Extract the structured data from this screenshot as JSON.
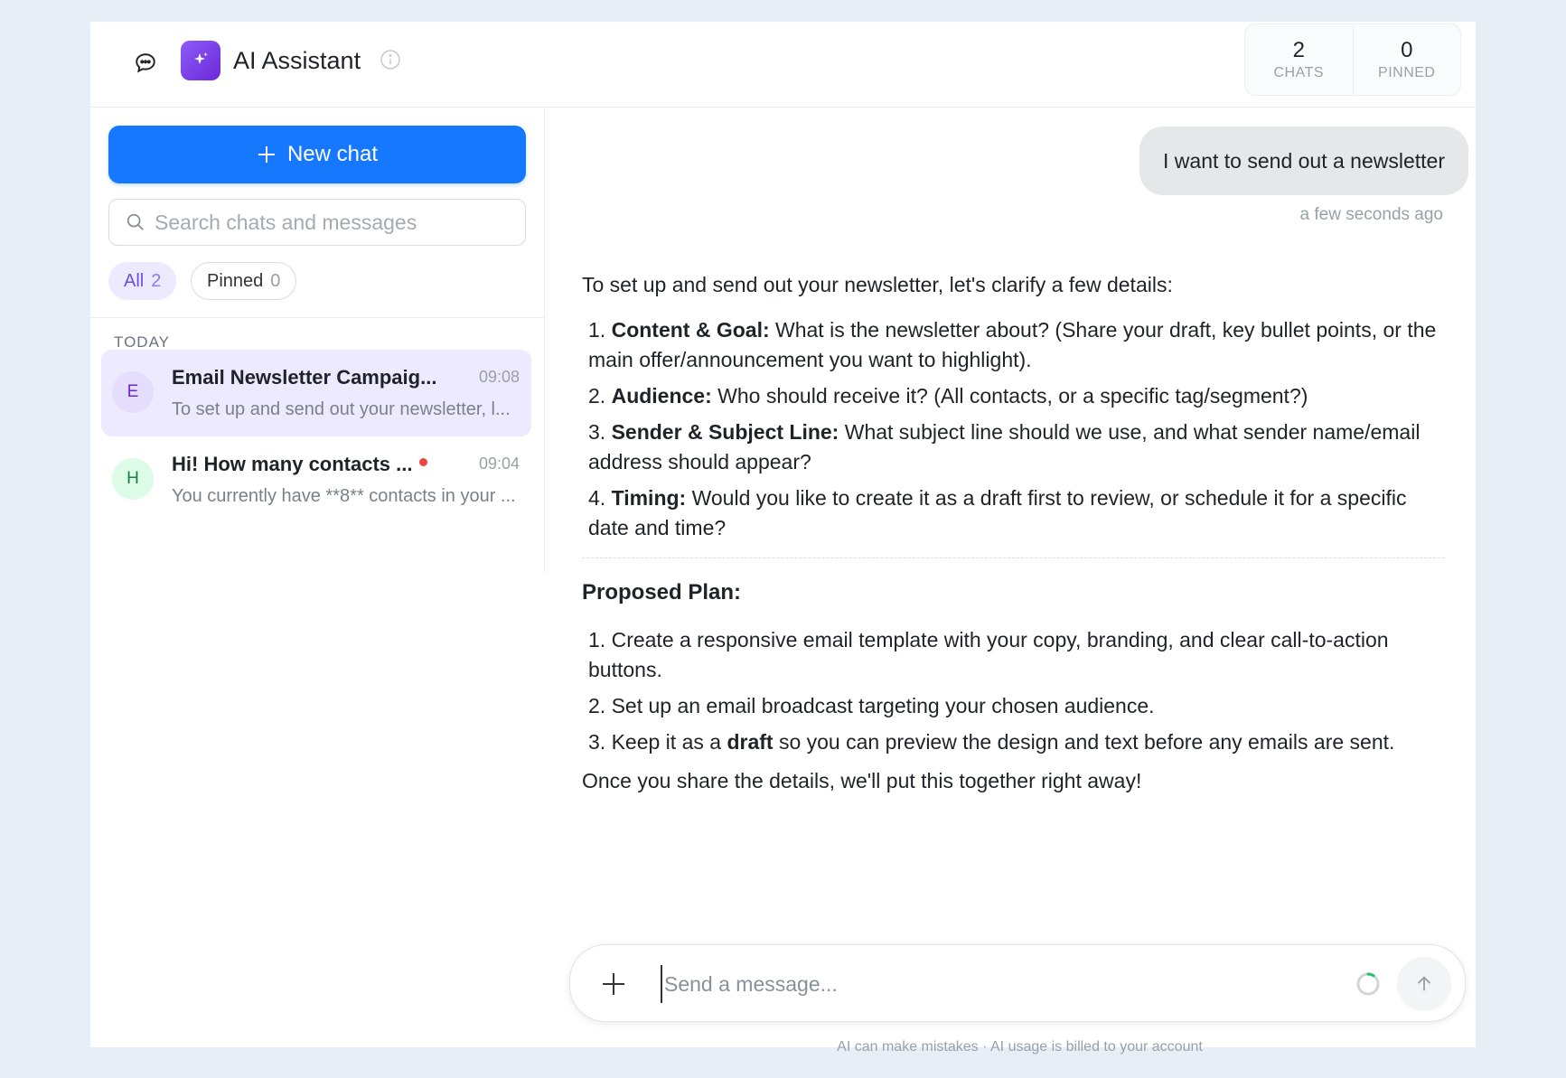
{
  "header": {
    "title": "AI Assistant",
    "stats": [
      {
        "value": "2",
        "label": "CHATS"
      },
      {
        "value": "0",
        "label": "PINNED"
      }
    ]
  },
  "sidebar": {
    "new_chat_label": "New chat",
    "search_placeholder": "Search chats and messages",
    "filters": [
      {
        "label": "All",
        "count": "2"
      },
      {
        "label": "Pinned",
        "count": "0"
      }
    ],
    "section_label": "TODAY",
    "conversations": [
      {
        "initial": "E",
        "title": "Email Newsletter Campaig...",
        "time": "09:08",
        "preview": "To set up and send out your newsletter, l...",
        "active": true
      },
      {
        "initial": "H",
        "title": "Hi! How many contacts ...",
        "time": "09:04",
        "preview": "You currently have **8** contacts in your ...",
        "unread": true
      }
    ]
  },
  "chat": {
    "user_message": "I want to send out a newsletter",
    "user_message_time": "a few seconds ago",
    "assistant": {
      "intro": "To set up and send out your newsletter, let's clarify a few details:",
      "details": [
        {
          "num": "1.",
          "bold": "Content & Goal:",
          "text": "What is the newsletter about? (Share your draft, key bullet points, or the main offer/announcement you want to highlight)."
        },
        {
          "num": "2.",
          "bold": "Audience:",
          "text": "Who should receive it? (All contacts, or a specific tag/segment?)"
        },
        {
          "num": "3.",
          "bold": "Sender & Subject Line:",
          "text": "What subject line should we use, and what sender name/email address should appear?"
        },
        {
          "num": "4.",
          "bold": "Timing:",
          "text": "Would you like to create it as a draft first to review, or schedule it for a specific date and time?"
        }
      ],
      "plan_heading": "Proposed Plan:",
      "plan": [
        {
          "num": "1.",
          "text": "Create a responsive email template with your copy, branding, and clear call-to-action buttons."
        },
        {
          "num": "2.",
          "text": "Set up an email broadcast targeting your chosen audience."
        },
        {
          "num": "3.",
          "pre": "Keep it as a",
          "bold": "draft",
          "post": "so you can preview the design and text before any emails are sent."
        }
      ],
      "closing": "Once you share the details, we'll put this together right away!"
    }
  },
  "composer": {
    "placeholder": "Send a message...",
    "disclaimer": "AI can make mistakes · AI usage is billed to your account"
  },
  "colors": {
    "accent": "#1677ff",
    "brand": "#7c3aed",
    "active_bg": "#ede9fe",
    "page_bg": "#e8eef6"
  }
}
